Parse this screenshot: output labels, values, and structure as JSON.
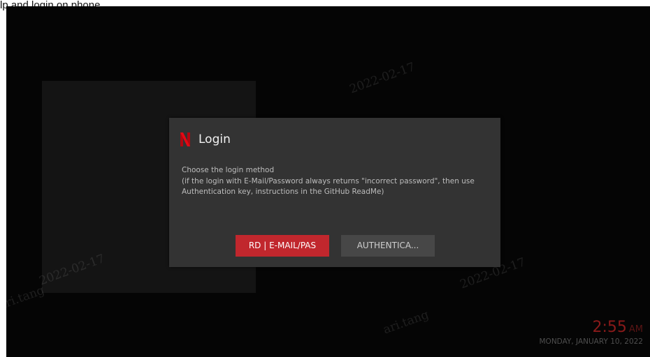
{
  "caption": "lp and login on phone",
  "watermark": {
    "user": "ari.tang",
    "date": "2022-02-17"
  },
  "dialog": {
    "title": "Login",
    "message": "Choose the login method\n(if the login with E-Mail/Password always returns \"incorrect password\", then use Authentication key, instructions in the GitHub ReadMe)",
    "primary_button": "RD | E-MAIL/PAS",
    "secondary_button": "AUTHENTICA..."
  },
  "clock": {
    "time": "2:55",
    "ampm": "AM",
    "date": "MONDAY, JANUARY 10, 2022"
  },
  "colors": {
    "accent": "#c1272d",
    "background": "#050505",
    "dialog": "#333333"
  }
}
